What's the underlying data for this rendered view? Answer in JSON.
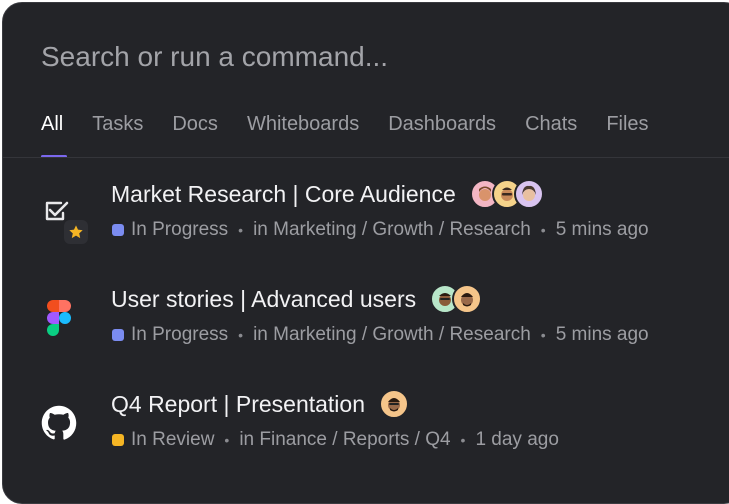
{
  "search": {
    "placeholder": "Search or run a command..."
  },
  "tabs": [
    {
      "label": "All"
    },
    {
      "label": "Tasks"
    },
    {
      "label": "Docs"
    },
    {
      "label": "Whiteboards"
    },
    {
      "label": "Dashboards"
    },
    {
      "label": "Chats"
    },
    {
      "label": "Files"
    }
  ],
  "colors": {
    "panel_bg": "#232428",
    "accent": "#7b68ee",
    "status_in_progress": "#7b8cf0",
    "status_in_review": "#f5b524",
    "favorite_star": "#f5b524"
  },
  "results": [
    {
      "icon": "task-check-icon",
      "badge_icon": "star-icon",
      "title": "Market Research | Core Audience",
      "status": "In Progress",
      "location": "in Marketing / Growth / Research",
      "time": "5 mins ago",
      "avatars": [
        "avatar-1",
        "avatar-2",
        "avatar-3"
      ]
    },
    {
      "icon": "figma-icon",
      "title": "User stories | Advanced users",
      "status": "In Progress",
      "location": "in Marketing / Growth / Research",
      "time": "5 mins ago",
      "avatars": [
        "avatar-4",
        "avatar-5"
      ]
    },
    {
      "icon": "github-icon",
      "title": "Q4 Report | Presentation",
      "status": "In Review",
      "location": "in Finance / Reports / Q4",
      "time": "1 day ago",
      "avatars": [
        "avatar-6"
      ]
    }
  ]
}
